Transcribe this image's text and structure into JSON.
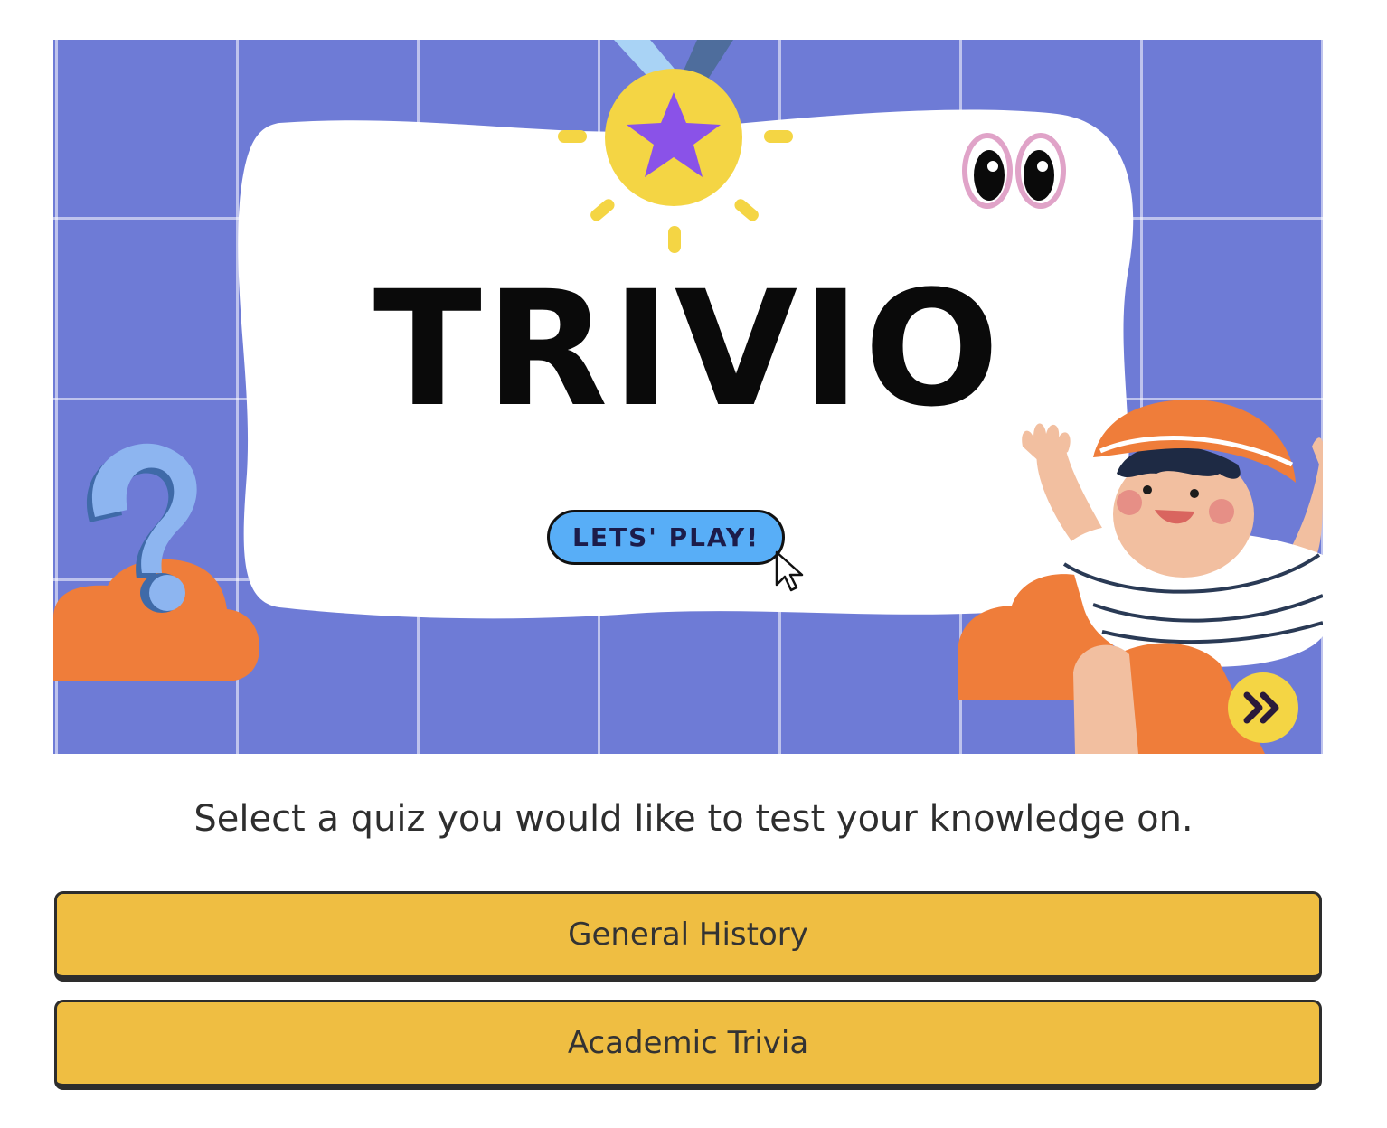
{
  "hero": {
    "title": "TRIVIO",
    "play_label": "LETS' PLAY!",
    "icons": [
      "medal-icon",
      "googly-eyes-icon",
      "question-mark-icon",
      "cloud-icon",
      "child-illustration",
      "mouse-cursor-icon",
      "double-chevron-right-icon"
    ]
  },
  "prompt": "Select a quiz you would like to test your knowledge on.",
  "quizzes": [
    {
      "label": "General History"
    },
    {
      "label": "Academic Trivia"
    }
  ],
  "colors": {
    "hero_background": "#6e7bd6",
    "quiz_button": "#efbe42",
    "play_button": "#58aef7",
    "accent_orange": "#ef7d3a",
    "medal_yellow": "#f4d544"
  }
}
